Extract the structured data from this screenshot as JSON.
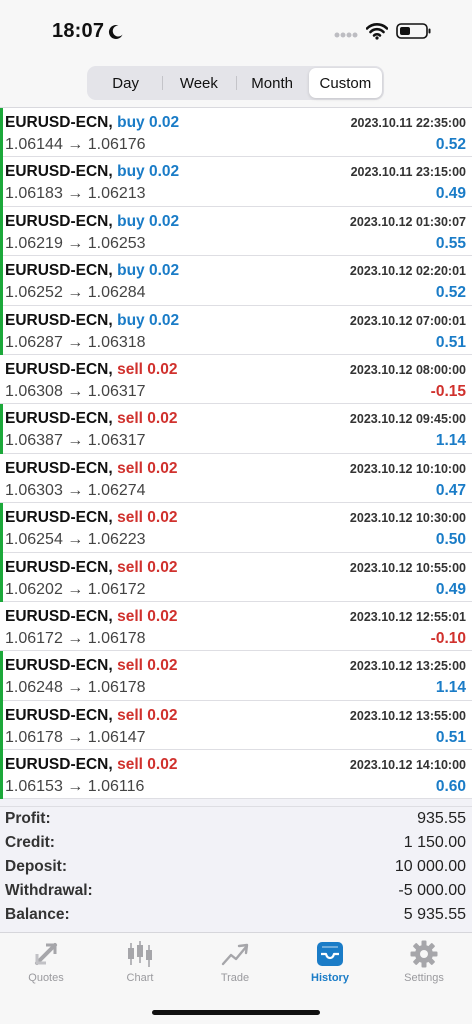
{
  "status_bar": {
    "time": "18:07"
  },
  "segments": [
    {
      "label": "Day",
      "active": false
    },
    {
      "label": "Week",
      "active": false
    },
    {
      "label": "Month",
      "active": false
    },
    {
      "label": "Custom",
      "active": true
    }
  ],
  "trades": [
    {
      "symbol": "EURUSD-ECN,",
      "action": "buy 0.02",
      "side": "buy",
      "datetime": "2023.10.11 22:35:00",
      "prices": "1.06144 → 1.06176",
      "pl": "0.52",
      "bar": true
    },
    {
      "symbol": "EURUSD-ECN,",
      "action": "buy 0.02",
      "side": "buy",
      "datetime": "2023.10.11 23:15:00",
      "prices": "1.06183 → 1.06213",
      "pl": "0.49",
      "bar": true
    },
    {
      "symbol": "EURUSD-ECN,",
      "action": "buy 0.02",
      "side": "buy",
      "datetime": "2023.10.12 01:30:07",
      "prices": "1.06219 → 1.06253",
      "pl": "0.55",
      "bar": true
    },
    {
      "symbol": "EURUSD-ECN,",
      "action": "buy 0.02",
      "side": "buy",
      "datetime": "2023.10.12 02:20:01",
      "prices": "1.06252 → 1.06284",
      "pl": "0.52",
      "bar": true
    },
    {
      "symbol": "EURUSD-ECN,",
      "action": "buy 0.02",
      "side": "buy",
      "datetime": "2023.10.12 07:00:01",
      "prices": "1.06287 → 1.06318",
      "pl": "0.51",
      "bar": true
    },
    {
      "symbol": "EURUSD-ECN,",
      "action": "sell 0.02",
      "side": "sell",
      "datetime": "2023.10.12 08:00:00",
      "prices": "1.06308 → 1.06317",
      "pl": "-0.15",
      "bar": false
    },
    {
      "symbol": "EURUSD-ECN,",
      "action": "sell 0.02",
      "side": "sell",
      "datetime": "2023.10.12 09:45:00",
      "prices": "1.06387 → 1.06317",
      "pl": "1.14",
      "bar": true
    },
    {
      "symbol": "EURUSD-ECN,",
      "action": "sell 0.02",
      "side": "sell",
      "datetime": "2023.10.12 10:10:00",
      "prices": "1.06303 → 1.06274",
      "pl": "0.47",
      "bar": false
    },
    {
      "symbol": "EURUSD-ECN,",
      "action": "sell 0.02",
      "side": "sell",
      "datetime": "2023.10.12 10:30:00",
      "prices": "1.06254 → 1.06223",
      "pl": "0.50",
      "bar": true
    },
    {
      "symbol": "EURUSD-ECN,",
      "action": "sell 0.02",
      "side": "sell",
      "datetime": "2023.10.12 10:55:00",
      "prices": "1.06202 → 1.06172",
      "pl": "0.49",
      "bar": true
    },
    {
      "symbol": "EURUSD-ECN,",
      "action": "sell 0.02",
      "side": "sell",
      "datetime": "2023.10.12 12:55:01",
      "prices": "1.06172 → 1.06178",
      "pl": "-0.10",
      "bar": false
    },
    {
      "symbol": "EURUSD-ECN,",
      "action": "sell 0.02",
      "side": "sell",
      "datetime": "2023.10.12 13:25:00",
      "prices": "1.06248 → 1.06178",
      "pl": "1.14",
      "bar": true
    },
    {
      "symbol": "EURUSD-ECN,",
      "action": "sell 0.02",
      "side": "sell",
      "datetime": "2023.10.12 13:55:00",
      "prices": "1.06178 → 1.06147",
      "pl": "0.51",
      "bar": true
    },
    {
      "symbol": "EURUSD-ECN,",
      "action": "sell 0.02",
      "side": "sell",
      "datetime": "2023.10.12 14:10:00",
      "prices": "1.06153 → 1.06116",
      "pl": "0.60",
      "bar": true
    }
  ],
  "summary": {
    "profit_label": "Profit:",
    "profit": "935.55",
    "credit_label": "Credit:",
    "credit": "1 150.00",
    "deposit_label": "Deposit:",
    "deposit": "10 000.00",
    "withdrawal_label": "Withdrawal:",
    "withdrawal": "-5 000.00",
    "balance_label": "Balance:",
    "balance": "5 935.55"
  },
  "tabs": [
    {
      "label": "Quotes",
      "icon": "quotes-icon",
      "active": false
    },
    {
      "label": "Chart",
      "icon": "candlestick-chart-icon",
      "active": false
    },
    {
      "label": "Trade",
      "icon": "trade-icon",
      "active": false
    },
    {
      "label": "History",
      "icon": "history-inbox-icon",
      "active": true
    },
    {
      "label": "Settings",
      "icon": "gear-icon",
      "active": false
    }
  ],
  "colors": {
    "buy": "#1a7cc7",
    "sell": "#d0312d",
    "profit_bar": "#1ca83a",
    "accent": "#1a7cc7"
  }
}
